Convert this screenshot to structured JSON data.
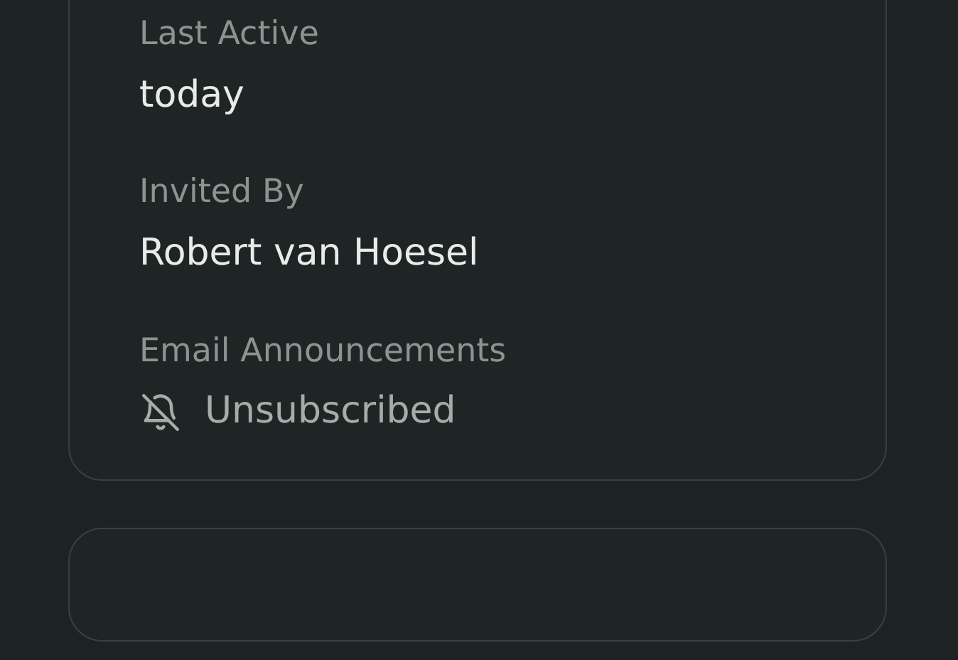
{
  "details": [
    {
      "label": "Last Active",
      "value": "today",
      "kind": "text"
    },
    {
      "label": "Invited By",
      "value": "Robert van Hoesel",
      "kind": "text"
    },
    {
      "label": "Email Announcements",
      "value": "Unsubscribed",
      "kind": "unsubscribed"
    }
  ]
}
